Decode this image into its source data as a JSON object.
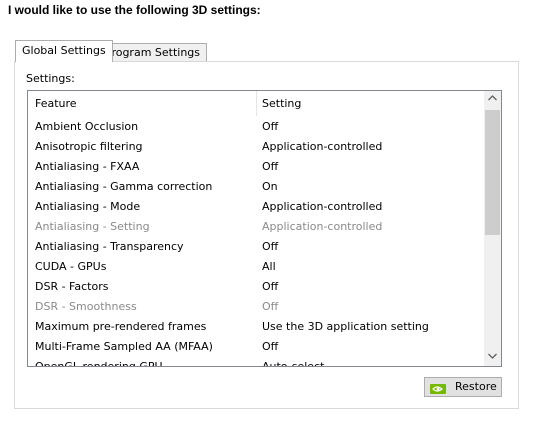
{
  "heading": "I would like to use the following 3D settings:",
  "tabs": [
    {
      "label": "Global Settings",
      "active": true
    },
    {
      "label": "Program Settings",
      "active": false
    }
  ],
  "settings_label": "Settings:",
  "columns": {
    "feature": "Feature",
    "setting": "Setting"
  },
  "rows": [
    {
      "feature": "Ambient Occlusion",
      "setting": "Off",
      "disabled": false
    },
    {
      "feature": "Anisotropic filtering",
      "setting": "Application-controlled",
      "disabled": false
    },
    {
      "feature": "Antialiasing - FXAA",
      "setting": "Off",
      "disabled": false
    },
    {
      "feature": "Antialiasing - Gamma correction",
      "setting": "On",
      "disabled": false
    },
    {
      "feature": "Antialiasing - Mode",
      "setting": "Application-controlled",
      "disabled": false
    },
    {
      "feature": "Antialiasing - Setting",
      "setting": "Application-controlled",
      "disabled": true
    },
    {
      "feature": "Antialiasing - Transparency",
      "setting": "Off",
      "disabled": false
    },
    {
      "feature": "CUDA - GPUs",
      "setting": "All",
      "disabled": false
    },
    {
      "feature": "DSR - Factors",
      "setting": "Off",
      "disabled": false
    },
    {
      "feature": "DSR - Smoothness",
      "setting": "Off",
      "disabled": true
    },
    {
      "feature": "Maximum pre-rendered frames",
      "setting": "Use the 3D application setting",
      "disabled": false
    },
    {
      "feature": "Multi-Frame Sampled AA (MFAA)",
      "setting": "Off",
      "disabled": false
    },
    {
      "feature": "OpenGL rendering GPU",
      "setting": "Auto-select",
      "disabled": false
    }
  ],
  "scrollbar": {
    "up_icon": "chevron-up-icon",
    "down_icon": "chevron-down-icon",
    "thumb_fraction": 0.5
  },
  "restore": {
    "label": "Restore",
    "icon": "nvidia-logo-icon"
  },
  "colors": {
    "nvidia_green": "#76b900",
    "disabled_text": "#8a8a8a"
  }
}
